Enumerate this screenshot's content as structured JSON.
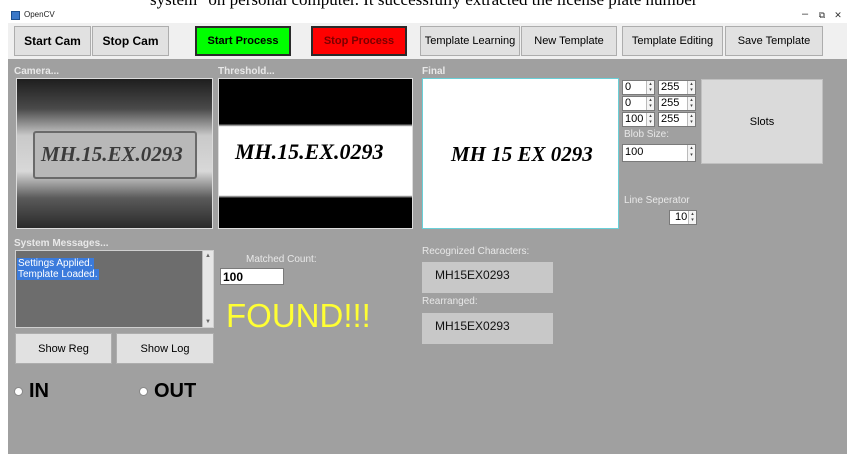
{
  "caption_fragment": "system\" on personal computer. It successfully extracted the license plate number",
  "window": {
    "title": "OpenCV",
    "minimize": "–",
    "restore": "⧉",
    "close": "✕"
  },
  "toolbar": {
    "start_cam": "Start Cam",
    "stop_cam": "Stop Cam",
    "start_process": "Start Process",
    "stop_process": "Stop Process",
    "template_learning": "Template Learning",
    "new_template": "New Template",
    "template_editing": "Template Editing",
    "save_template": "Save Template"
  },
  "panels": {
    "camera": {
      "label": "Camera...",
      "plate": "MH.15.EX.0293"
    },
    "threshold": {
      "label": "Threshold...",
      "plate": "MH.15.EX.0293"
    },
    "final": {
      "label": "Final",
      "plate": "MH 15 EX 0293"
    }
  },
  "threshold_controls": {
    "rows": [
      {
        "min": "0",
        "max": "255"
      },
      {
        "min": "0",
        "max": "255"
      },
      {
        "min": "100",
        "max": "255"
      }
    ],
    "blob_size_label": "Blob Size:",
    "blob_size": "100",
    "slots_button": "Slots",
    "line_separator_label": "Line Seperator",
    "line_separator": "10"
  },
  "system_messages": {
    "label": "System Messages...",
    "lines": [
      "Settings Applied.",
      "Template Loaded."
    ]
  },
  "matched": {
    "label": "Matched Count:",
    "value": "100",
    "status": "FOUND!!!"
  },
  "recognized": {
    "label": "Recognized Characters:",
    "value": "MH15EX0293"
  },
  "rearranged": {
    "label": "Rearranged:",
    "value": "MH15EX0293"
  },
  "buttons": {
    "show_reg": "Show Reg",
    "show_log": "Show Log"
  },
  "direction": {
    "in_label": "IN",
    "out_label": "OUT"
  },
  "colors": {
    "start_process": "#00ff00",
    "stop_process": "#ff0000",
    "found": "#ffff33",
    "selection": "#3b7bdc"
  }
}
